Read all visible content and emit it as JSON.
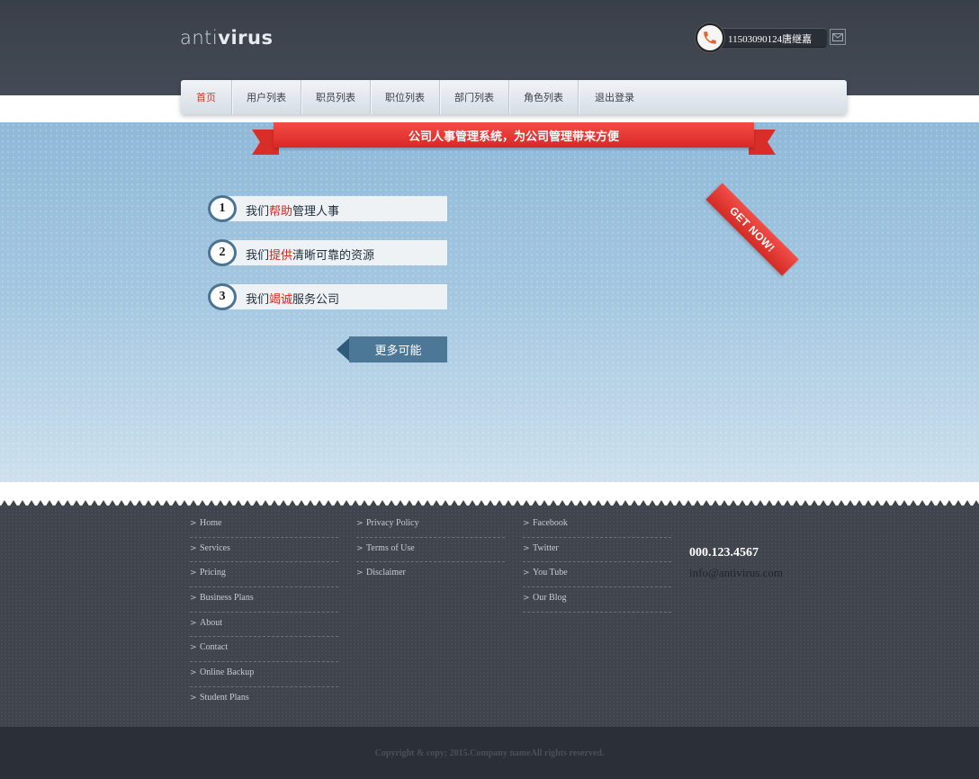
{
  "header": {
    "logo_light": "anti",
    "logo_bold": "virus",
    "phone_label": "11503090124唐继嘉",
    "phone_icon": "phone-icon",
    "mail_icon": "mail-icon"
  },
  "nav": {
    "items": [
      {
        "label": "首页",
        "active": true
      },
      {
        "label": "用户列表",
        "active": false
      },
      {
        "label": "职员列表",
        "active": false
      },
      {
        "label": "职位列表",
        "active": false
      },
      {
        "label": "部门列表",
        "active": false
      },
      {
        "label": "角色列表",
        "active": false
      },
      {
        "label": "退出登录",
        "active": false
      }
    ]
  },
  "hero": {
    "banner": "公司人事管理系统，为公司管理带来方便",
    "features": [
      {
        "num": "1",
        "pre": "我们",
        "hl": "帮助",
        "post": "管理人事"
      },
      {
        "num": "2",
        "pre": "我们",
        "hl": "提供",
        "post": "清晰可靠的资源"
      },
      {
        "num": "3",
        "pre": "我们",
        "hl": "竭诚",
        "post": "服务公司"
      }
    ],
    "more_button": "更多可能",
    "get_now": "GET NOW!"
  },
  "footer": {
    "col1": [
      "Home",
      "Services",
      "Pricing",
      "Business Plans",
      "About",
      "Contact",
      "Online Backup",
      "Student Plans"
    ],
    "col2": [
      "Privacy Policy",
      "Terms of Use",
      "Disclaimer"
    ],
    "col3": [
      "Facebook",
      "Twitter",
      "You Tube",
      "Our Blog"
    ],
    "phone": "000.123.4567",
    "email": "info@antivirus.com",
    "copyright": "Copyright & copy; 2015.Company nameAll rights reserved."
  },
  "colors": {
    "header_bg": "#3f444e",
    "accent_red": "#d4241f",
    "hero_blue": "#9cc3df",
    "button_blue": "#4c7797",
    "footer_bg": "#3f444d"
  }
}
